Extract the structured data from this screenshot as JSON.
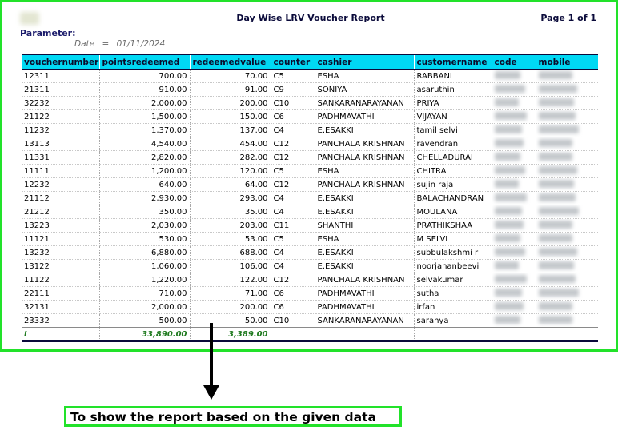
{
  "report": {
    "title": "Day Wise LRV Voucher Report",
    "page_info": "Page 1 of 1",
    "parameter_label": "Parameter:",
    "parameter": {
      "name": "Date",
      "separator": "=",
      "value": "01/11/2024"
    },
    "columns": [
      "vouchernumber",
      "pointsredeemed",
      "redeemedvalue",
      "counter",
      "cashier",
      "customername",
      "code",
      "mobile"
    ],
    "rows": [
      [
        "12311",
        "700.00",
        "70.00",
        "C5",
        "ESHA",
        "RABBANI"
      ],
      [
        "21311",
        "910.00",
        "91.00",
        "C9",
        "SONIYA",
        "asaruthin"
      ],
      [
        "32232",
        "2,000.00",
        "200.00",
        "C10",
        "SANKARANARAYANAN",
        "PRIYA"
      ],
      [
        "21122",
        "1,500.00",
        "150.00",
        "C6",
        "PADHMAVATHI",
        "VIJAYAN"
      ],
      [
        "11232",
        "1,370.00",
        "137.00",
        "C4",
        "E.ESAKKI",
        "tamil selvi"
      ],
      [
        "13113",
        "4,540.00",
        "454.00",
        "C12",
        "PANCHALA KRISHNAN",
        "ravendran"
      ],
      [
        "11331",
        "2,820.00",
        "282.00",
        "C12",
        "PANCHALA KRISHNAN",
        "CHELLADURAI"
      ],
      [
        "11111",
        "1,200.00",
        "120.00",
        "C5",
        "ESHA",
        "CHITRA"
      ],
      [
        "12232",
        "640.00",
        "64.00",
        "C12",
        "PANCHALA KRISHNAN",
        "sujin raja"
      ],
      [
        "21112",
        "2,930.00",
        "293.00",
        "C4",
        "E.ESAKKI",
        "BALACHANDRAN"
      ],
      [
        "21212",
        "350.00",
        "35.00",
        "C4",
        "E.ESAKKI",
        "MOULANA"
      ],
      [
        "13223",
        "2,030.00",
        "203.00",
        "C11",
        "SHANTHI",
        "PRATHIKSHAA"
      ],
      [
        "11121",
        "530.00",
        "53.00",
        "C5",
        "ESHA",
        "M SELVI"
      ],
      [
        "13232",
        "6,880.00",
        "688.00",
        "C4",
        "E.ESAKKI",
        "subbulakshmi r"
      ],
      [
        "13122",
        "1,060.00",
        "106.00",
        "C4",
        "E.ESAKKI",
        "noorjahanbeevi"
      ],
      [
        "11122",
        "1,220.00",
        "122.00",
        "C12",
        "PANCHALA KRISHNAN",
        "selvakumar"
      ],
      [
        "22111",
        "710.00",
        "71.00",
        "C6",
        "PADHMAVATHI",
        "sutha"
      ],
      [
        "32131",
        "2,000.00",
        "200.00",
        "C6",
        "PADHMAVATHI",
        "irfan"
      ],
      [
        "23332",
        "500.00",
        "50.00",
        "C10",
        "SANKARANARAYANAN",
        "saranya"
      ]
    ],
    "totals": {
      "label": "I",
      "pointsredeemed": "33,890.00",
      "redeemedvalue": "3,389.00"
    }
  },
  "annotation": {
    "caption": "To show the report based on the given data",
    "frame_color": "#22e22a",
    "header_color": "#00d8f4",
    "total_color": "#1f7a1f"
  }
}
